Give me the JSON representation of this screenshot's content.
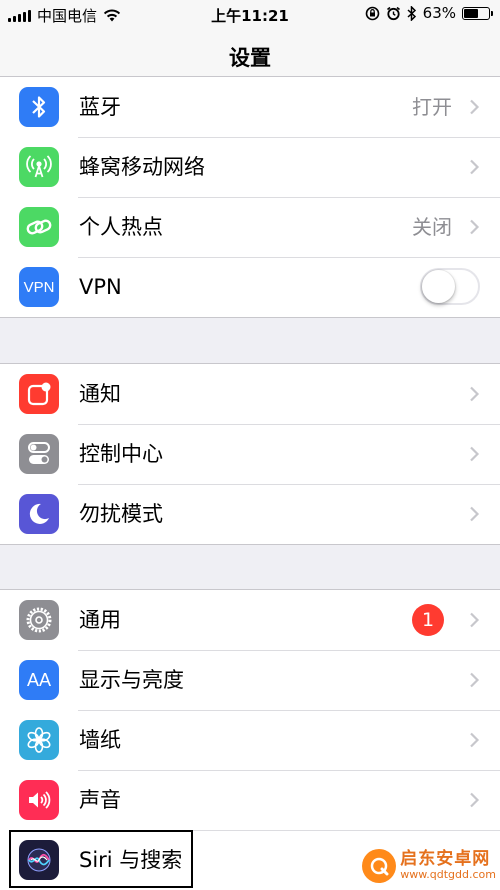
{
  "status_bar": {
    "carrier": "中国电信",
    "time": "上午11:21",
    "battery": "63%",
    "battery_level": 0.63
  },
  "nav": {
    "title": "设置"
  },
  "group1": [
    {
      "label": "蓝牙",
      "value": "打开",
      "icon": "bluetooth-icon",
      "color": "#2f7cf6"
    },
    {
      "label": "蜂窝移动网络",
      "value": "",
      "icon": "cellular-icon",
      "color": "#4cd964"
    },
    {
      "label": "个人热点",
      "value": "关闭",
      "icon": "hotspot-icon",
      "color": "#4cd964"
    },
    {
      "label": "VPN",
      "icon_text": "VPN",
      "toggle": false,
      "color": "#2f7cf6"
    }
  ],
  "group2": [
    {
      "label": "通知",
      "icon": "notifications-icon",
      "color": "#ff3b30"
    },
    {
      "label": "控制中心",
      "icon": "control-center-icon",
      "color": "#8e8e93"
    },
    {
      "label": "勿扰模式",
      "icon": "moon-icon",
      "color": "#5856d6"
    }
  ],
  "group3": [
    {
      "label": "通用",
      "badge": "1",
      "icon": "gear-icon",
      "color": "#8e8e93"
    },
    {
      "label": "显示与亮度",
      "icon_text": "AA",
      "color": "#2f7cf6"
    },
    {
      "label": "墙纸",
      "icon": "flower-icon",
      "color": "#34aadc"
    },
    {
      "label": "声音",
      "icon": "speaker-icon",
      "color": "#ff2d55"
    },
    {
      "label": "Siri 与搜索",
      "icon": "siri-icon",
      "color": "#1c1c3a"
    }
  ],
  "watermark": {
    "line1": "启东安卓网",
    "line2": "www.qdtgdd.com"
  }
}
